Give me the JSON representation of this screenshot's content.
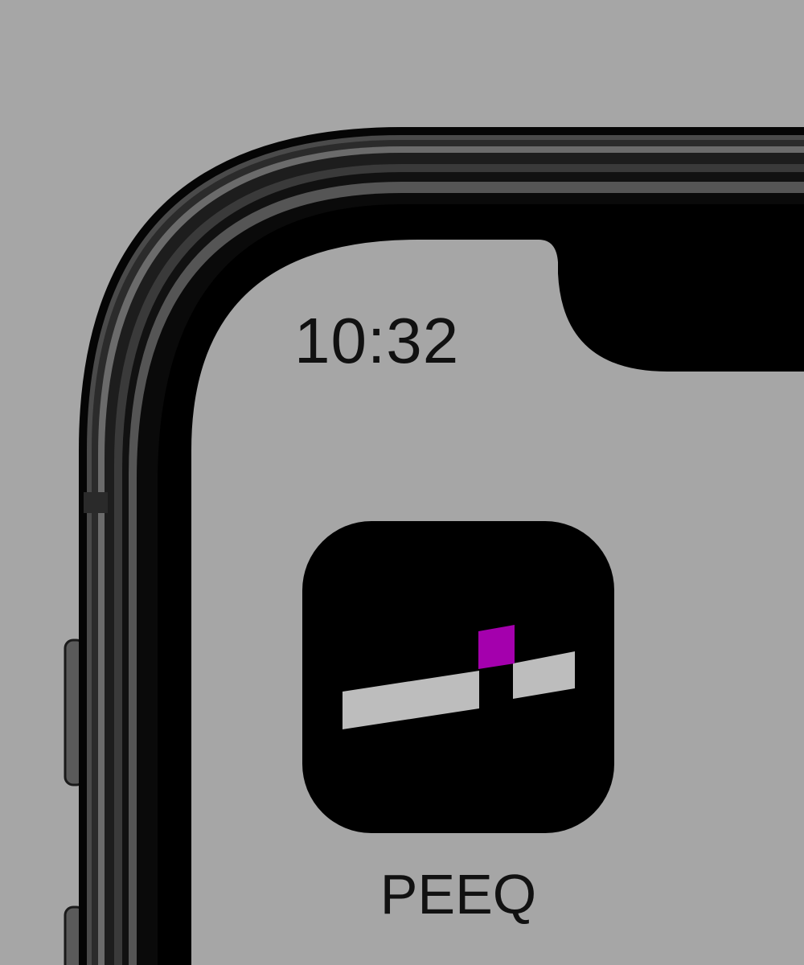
{
  "status_bar": {
    "time": "10:32"
  },
  "home_screen": {
    "apps": [
      {
        "label": "PEEQ",
        "icon": "peeq-app-icon",
        "accent_color": "#a400ad"
      }
    ]
  },
  "colors": {
    "wallpaper": "#a6a6a6",
    "frame": "#000000",
    "icon_background": "#000000",
    "icon_bar": "#bdbdbd",
    "icon_accent": "#a400ad"
  }
}
